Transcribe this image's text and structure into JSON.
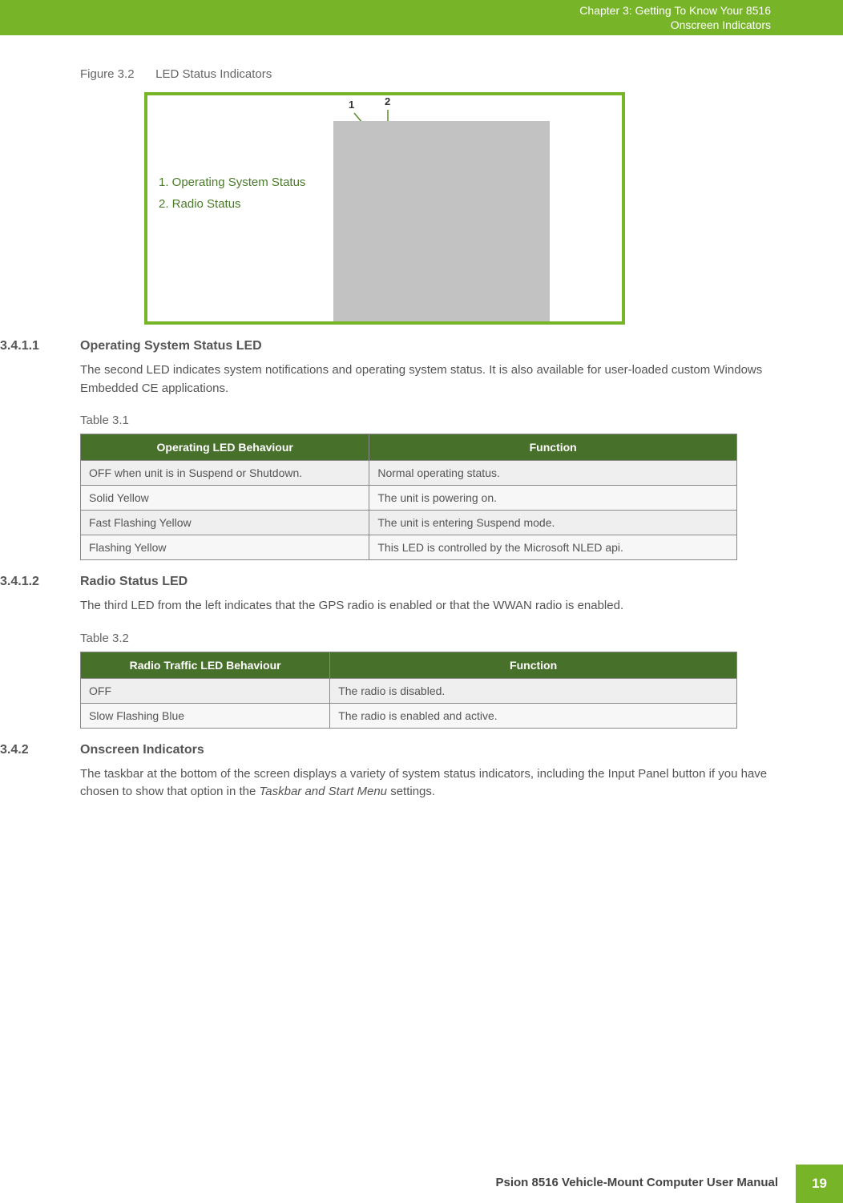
{
  "header": {
    "chapter_line": "Chapter 3:  Getting To Know Your 8516",
    "section_line": "Onscreen Indicators"
  },
  "figure": {
    "label": "Figure 3.2",
    "title": "LED Status Indicators",
    "callouts": {
      "one": "1",
      "two": "2"
    },
    "legend": {
      "line1": "1. Operating System Status",
      "line2": "2. Radio Status"
    }
  },
  "s1": {
    "num": "3.4.1.1",
    "title": "Operating System Status LED",
    "body": "The second LED indicates system notifications and operating system status. It is also available for user-loaded custom Windows Embedded CE applications.",
    "table_label": "Table 3.1",
    "th1": "Operating LED Behaviour",
    "th2": "Function",
    "rows": [
      {
        "c1": "OFF when unit is in Suspend or Shutdown.",
        "c2": "Normal operating status."
      },
      {
        "c1": "Solid Yellow",
        "c2": "The unit is powering on."
      },
      {
        "c1": "Fast Flashing Yellow",
        "c2": "The unit is entering Suspend mode."
      },
      {
        "c1": "Flashing Yellow",
        "c2": "This LED is controlled by the Microsoft NLED api."
      }
    ]
  },
  "s2": {
    "num": "3.4.1.2",
    "title": "Radio Status LED",
    "body": "The third LED from the left indicates that the GPS radio is enabled or that the WWAN radio is enabled.",
    "table_label": "Table 3.2",
    "th1": "Radio Traffic LED Behaviour",
    "th2": "Function",
    "rows": [
      {
        "c1": "OFF",
        "c2": "The radio is disabled."
      },
      {
        "c1": "Slow Flashing Blue",
        "c2": "The radio is enabled and active."
      }
    ]
  },
  "s3": {
    "num": "3.4.2",
    "title": "Onscreen Indicators",
    "body_pre": "The taskbar at the bottom of the screen displays a variety of system status indicators, including the Input Panel button if you have chosen to show that option in the ",
    "body_italic": "Taskbar and Start Menu",
    "body_post": " settings."
  },
  "footer": {
    "text": "Psion 8516 Vehicle-Mount Computer User Manual",
    "page": "19"
  }
}
